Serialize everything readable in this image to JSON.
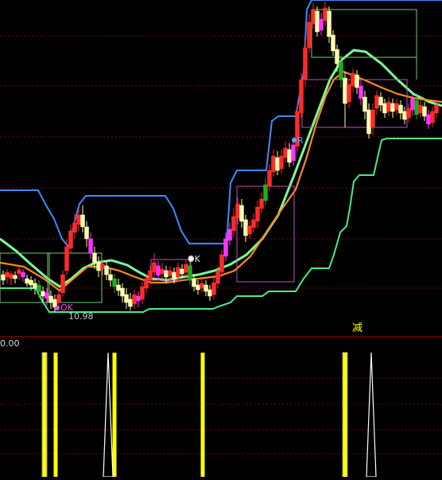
{
  "chart": {
    "indicator_axis_label": "0.00",
    "low_price_label": "10.98",
    "markers": [
      {
        "label": "OK",
        "color": "#ff40ff"
      },
      {
        "label": "OK",
        "color": "#e0e0e0"
      },
      {
        "label": "R",
        "color": "#55aaff"
      }
    ],
    "signal_label": "减",
    "colors": {
      "background": "#000000",
      "grid": "#7a0a0a",
      "divider": "#b00000",
      "upper_band": "#3a8cff",
      "lower_band": "#44ee88",
      "ma_orange": "#ff8a1e",
      "ma_green": "#7dff9a",
      "bull": "#ff2a2a",
      "bear": "#ffffb0",
      "signal_yellow": "#ffff00",
      "signal_white": "#ffffff"
    }
  },
  "chart_data": {
    "type": "candlestick",
    "description_source": "trading-software price panel with band indicator and signal sub-panel",
    "indicator_signals": {
      "yellow_bars_x_order": [
        1,
        2,
        4,
        7,
        10
      ],
      "white_spikes_x_order": [
        3,
        9
      ]
    }
  }
}
